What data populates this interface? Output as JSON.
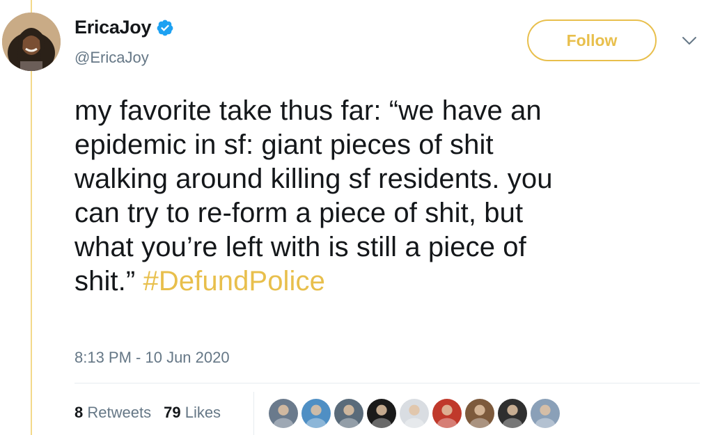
{
  "author": {
    "display_name": "EricaJoy",
    "handle": "@EricaJoy",
    "verified": true
  },
  "follow_button": {
    "label": "Follow"
  },
  "tweet": {
    "lines": [
      "my favorite take thus far: “we have an",
      "epidemic in sf: giant pieces of shit",
      "walking around killing sf residents. you",
      "can try to re-form a piece of shit, but",
      "what you’re left with is still a piece of"
    ],
    "last_line_text": "shit.” ",
    "hashtag": "#DefundPolice",
    "timestamp": "8:13 PM - 10 Jun 2020"
  },
  "stats": {
    "retweets_count": "8",
    "retweets_label": "Retweets",
    "likes_count": "79",
    "likes_label": "Likes"
  },
  "likers": [
    {
      "icon": "avatar-photo",
      "color": "#6a7a8c"
    },
    {
      "icon": "avatar-photo",
      "color": "#4f8fc4"
    },
    {
      "icon": "avatar-photo",
      "color": "#5a6b7a"
    },
    {
      "icon": "avatar-photo",
      "color": "#1a1a1a"
    },
    {
      "icon": "avatar-photo",
      "color": "#d9dde2"
    },
    {
      "icon": "avatar-photo",
      "color": "#c0392b"
    },
    {
      "icon": "avatar-photo",
      "color": "#7d5a3c"
    },
    {
      "icon": "avatar-photo",
      "color": "#2f2f2f"
    },
    {
      "icon": "avatar-photo",
      "color": "#8aa0b8"
    }
  ],
  "colors": {
    "accent": "#e8bf4c",
    "secondary_text": "#657786",
    "verified_badge": "#1da1f2"
  }
}
